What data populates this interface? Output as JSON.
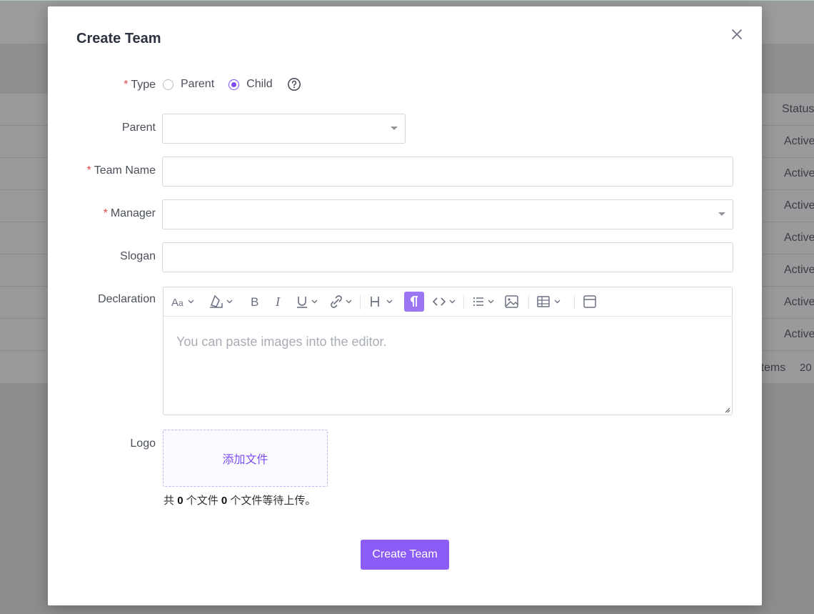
{
  "background": {
    "table_header_status": "Status",
    "rows": [
      "Active",
      "Active",
      "Active",
      "Active",
      "Active",
      "Active",
      "Active"
    ],
    "footer_items": "items",
    "footer_page_size": "20"
  },
  "modal": {
    "title": "Create Team",
    "fields": {
      "type_label": "Type",
      "type_options": [
        "Parent",
        "Child"
      ],
      "type_selected": "Child",
      "parent_label": "Parent",
      "parent_value": "",
      "team_name_label": "Team Name",
      "team_name_value": "",
      "manager_label": "Manager",
      "manager_value": "",
      "slogan_label": "Slogan",
      "slogan_value": "",
      "declaration_label": "Declaration",
      "declaration_placeholder": "You can paste images into the editor.",
      "logo_label": "Logo"
    },
    "upload": {
      "button_label": "添加文件",
      "summary_prefix": "共",
      "total_files": "0",
      "summary_mid": "个文件",
      "pending_files": "0",
      "summary_suffix": "个文件等待上传。"
    },
    "submit_label": "Create Team",
    "required_mark": "*"
  },
  "colors": {
    "accent": "#8b5cf6",
    "required": "#e5484d"
  },
  "icons": [
    "font-size-icon",
    "text-color-icon",
    "bold-icon",
    "italic-icon",
    "underline-icon",
    "link-icon",
    "heading-icon",
    "paragraph-icon",
    "code-icon",
    "list-icon",
    "image-icon",
    "table-icon",
    "fullscreen-icon",
    "help-icon",
    "close-icon"
  ]
}
